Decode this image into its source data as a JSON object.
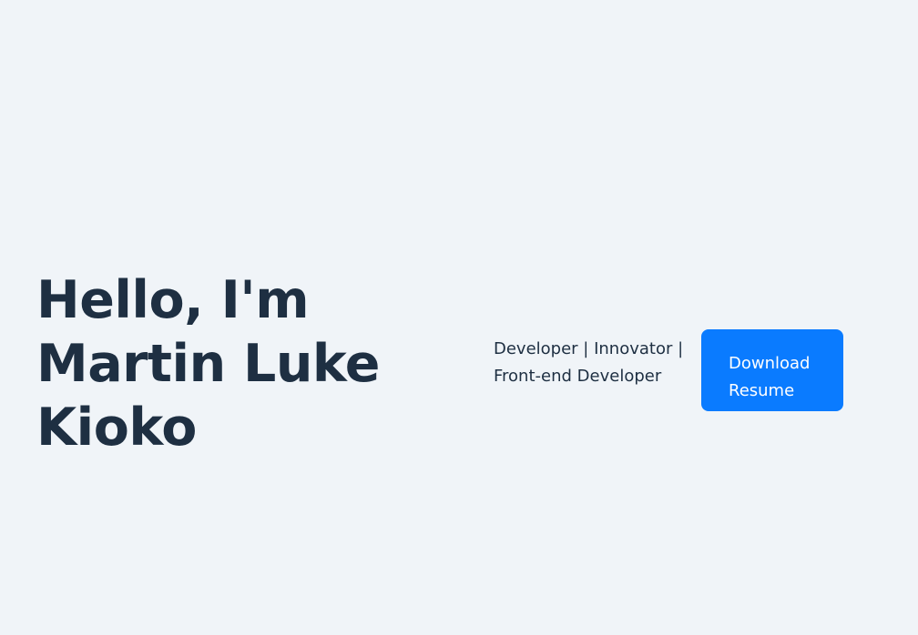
{
  "hero": {
    "title_lines": [
      "Hello, I'm",
      "Martin Luke",
      "Kioko"
    ],
    "tagline_lines": [
      "Developer | Innovator |",
      "Front-end Developer"
    ],
    "button_lines": [
      "Download",
      "Resume"
    ]
  },
  "colors": {
    "background": "#f0f4f8",
    "text": "#1e2f42",
    "accent": "#0a7bff",
    "button_text": "#ffffff"
  }
}
